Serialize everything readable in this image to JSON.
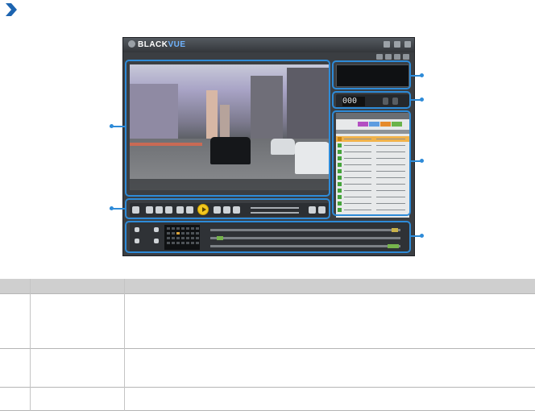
{
  "app": {
    "logo_prefix": "BLACK",
    "logo_suffix": "VUE"
  },
  "speed_display": "000",
  "colors": {
    "callout": "#2e8bd8",
    "accent_play": "#f2c71f",
    "file_icon": "#45a33a"
  },
  "icons": {
    "section": "chevron-right-icon"
  }
}
